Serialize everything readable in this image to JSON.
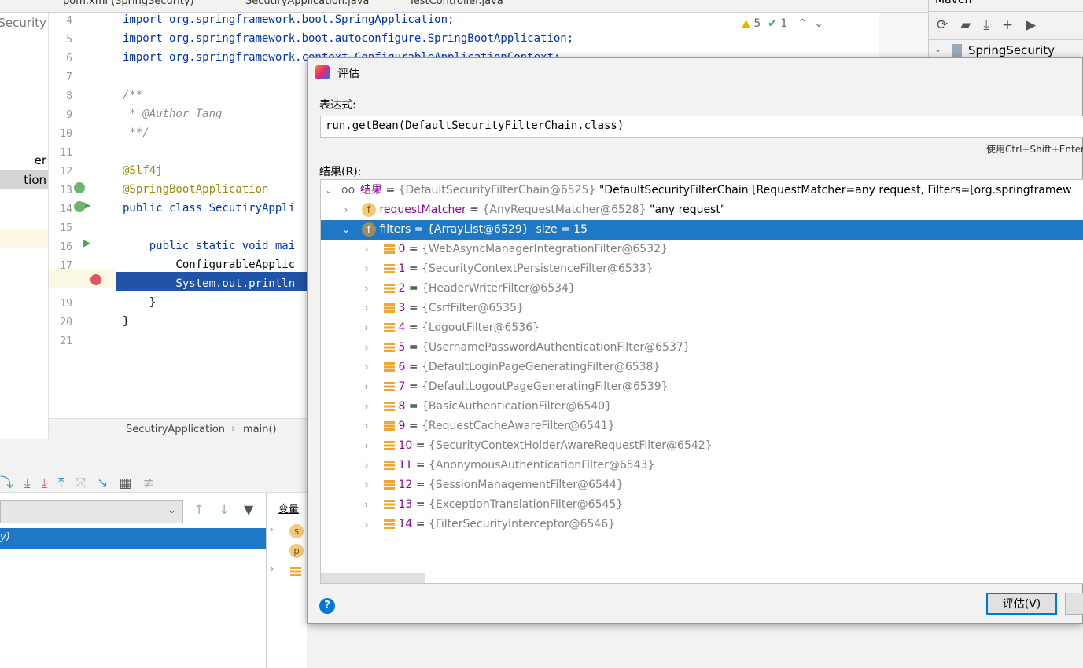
{
  "tabs": [
    {
      "label": "pom.xml (SpringSecurity)"
    },
    {
      "label": "SecutiryApplication.java"
    },
    {
      "label": "TestController.java"
    }
  ],
  "project": {
    "items": [
      "Security",
      "er",
      "tion"
    ]
  },
  "editor": {
    "inspections": {
      "warnings": "5",
      "ok": "1"
    },
    "lines": [
      {
        "n": "4",
        "code": "import org.springframework.boot.SpringApplication;"
      },
      {
        "n": "5",
        "code": "import org.springframework.boot.autoconfigure.SpringBootApplication;"
      },
      {
        "n": "6",
        "code": "import org.springframework.context.ConfigurableApplicationContext;"
      },
      {
        "n": "7",
        "code": ""
      },
      {
        "n": "8",
        "code": "/**"
      },
      {
        "n": "9",
        "code": " * @Author Tang"
      },
      {
        "n": "10",
        "code": " **/"
      },
      {
        "n": "11",
        "code": ""
      },
      {
        "n": "12",
        "code": "@Slf4j"
      },
      {
        "n": "13",
        "code": "@SpringBootApplication"
      },
      {
        "n": "14",
        "code": "public class SecutiryAppli"
      },
      {
        "n": "15",
        "code": ""
      },
      {
        "n": "16",
        "code": "    public static void mai"
      },
      {
        "n": "17",
        "code": "        ConfigurableApplic"
      },
      {
        "n": "18",
        "code": "        System.out.println"
      },
      {
        "n": "19",
        "code": "    }"
      },
      {
        "n": "20",
        "code": "}"
      },
      {
        "n": "21",
        "code": ""
      }
    ]
  },
  "breadcrumb": {
    "class": "SecutiryApplication",
    "method": "main()"
  },
  "maven": {
    "title": "Maven",
    "project": "SpringSecurity"
  },
  "debug": {
    "frame_selected": "y)",
    "vars_tab": "变量",
    "var_icons": [
      "s",
      "p"
    ]
  },
  "dialog": {
    "title": "评估",
    "expr_label": "表达式:",
    "expression": "run.getBean(DefaultSecurityFilterChain.class)",
    "hint": "使用Ctrl+Shift+Enter",
    "result_label": "结果(R):",
    "root": {
      "name": "结果",
      "type": "{DefaultSecurityFilterChain@6525}",
      "value": "\"DefaultSecurityFilterChain [RequestMatcher=any request, Filters=[org.springframew"
    },
    "matcher": {
      "name": "requestMatcher",
      "type": "{AnyRequestMatcher@6528}",
      "value": "\"any request\""
    },
    "filters": {
      "name": "filters",
      "type": "{ArrayList@6529}",
      "size": "size = 15"
    },
    "items": [
      {
        "i": "0",
        "v": "{WebAsyncManagerIntegrationFilter@6532}"
      },
      {
        "i": "1",
        "v": "{SecurityContextPersistenceFilter@6533}"
      },
      {
        "i": "2",
        "v": "{HeaderWriterFilter@6534}"
      },
      {
        "i": "3",
        "v": "{CsrfFilter@6535}"
      },
      {
        "i": "4",
        "v": "{LogoutFilter@6536}"
      },
      {
        "i": "5",
        "v": "{UsernamePasswordAuthenticationFilter@6537}"
      },
      {
        "i": "6",
        "v": "{DefaultLoginPageGeneratingFilter@6538}"
      },
      {
        "i": "7",
        "v": "{DefaultLogoutPageGeneratingFilter@6539}"
      },
      {
        "i": "8",
        "v": "{BasicAuthenticationFilter@6540}"
      },
      {
        "i": "9",
        "v": "{RequestCacheAwareFilter@6541}"
      },
      {
        "i": "10",
        "v": "{SecurityContextHolderAwareRequestFilter@6542}"
      },
      {
        "i": "11",
        "v": "{AnonymousAuthenticationFilter@6543}"
      },
      {
        "i": "12",
        "v": "{SessionManagementFilter@6544}"
      },
      {
        "i": "13",
        "v": "{ExceptionTranslationFilter@6545}"
      },
      {
        "i": "14",
        "v": "{FilterSecurityInterceptor@6546}"
      }
    ],
    "eval_button": "评估(V)",
    "colors": {
      "selection": "#1e78c6",
      "accent": "#0078d7"
    }
  }
}
